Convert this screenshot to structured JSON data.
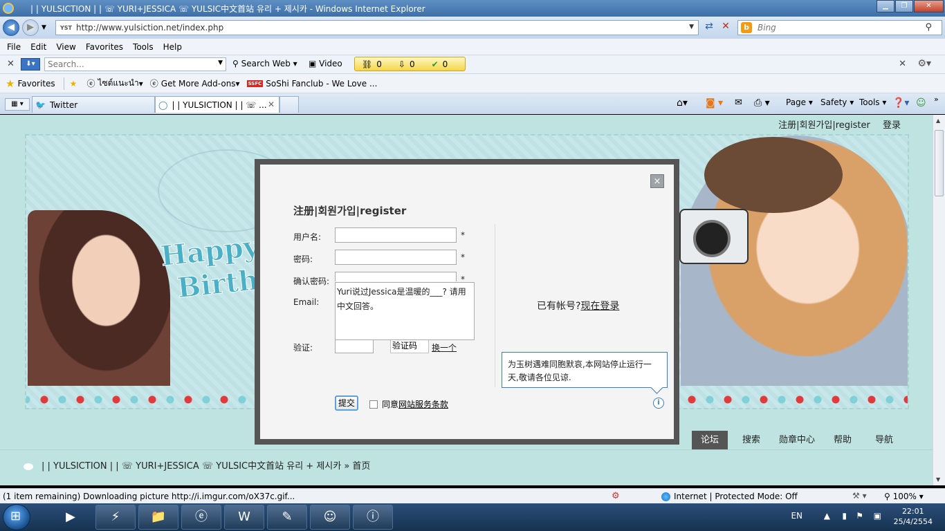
{
  "window": {
    "title": "| | YULSICTION | | ☏ YURI+JESSICA ☏ YULSIC中文首站 유리 + 제시카 - Windows Internet Explorer",
    "min_label": "▁",
    "max_label": "❐",
    "close_label": "✕"
  },
  "address": {
    "site_icon": "YST",
    "url": "http://www.yulsiction.net/index.php",
    "search_placeholder": "Bing"
  },
  "menu": [
    "File",
    "Edit",
    "View",
    "Favorites",
    "Tools",
    "Help"
  ],
  "toolbar": {
    "search_placeholder": "Search...",
    "search_web": "Search Web",
    "video": "Video",
    "counters": [
      "0",
      "0",
      "0"
    ]
  },
  "favorites": {
    "label": "Favorites",
    "items": [
      "ไซต์แนะนำ",
      "Get More Add-ons",
      "SoShi Fanclub - We Love ..."
    ],
    "ssfc_badge": "SSFC"
  },
  "tabs": [
    {
      "label": "Twitter"
    },
    {
      "label": "| | YULSICTION | | ☏ ..."
    }
  ],
  "commands": {
    "page": "Page",
    "safety": "Safety",
    "tools": "Tools"
  },
  "page": {
    "toplinks": "注册|회원가입|register",
    "login": "登录",
    "banner": {
      "happy": "Happy",
      "birth": "Birthd"
    },
    "navtabs": [
      "论坛",
      "搜索",
      "勋章中心",
      "帮助",
      "导航"
    ],
    "breadcrumb": "| | YULSICTION | | ☏ YURI+JESSICA ☏ YULSIC中文首站 유리 + 제시카 » 首页"
  },
  "modal": {
    "close": "×",
    "title": "注册|회원가입|register",
    "labels": {
      "username": "用户名:",
      "password": "密码:",
      "confirm": "确认密码:",
      "email": "Email:",
      "captcha": "验证:"
    },
    "required": "*",
    "question": "Yuri说过Jessica是温暖的___? 请用中文回答。",
    "captcha_text": "验证码",
    "change": "换一个",
    "has_account": "已有帐号?",
    "login_now": "现在登录",
    "notice": "为玉树遇难同胞默哀,本网站停止运行一天,敬请各位见谅.",
    "info": "i",
    "submit": "提交",
    "agree_prefix": "同意",
    "terms": "网站服务条款"
  },
  "status": {
    "text": "(1 item remaining) Downloading picture http://i.imgur.com/oX37c.gif...",
    "zone": "Internet | Protected Mode: Off",
    "zoom": "100%"
  },
  "taskbar": {
    "lang": "EN",
    "time": "22:01",
    "date": "25/4/2554"
  }
}
